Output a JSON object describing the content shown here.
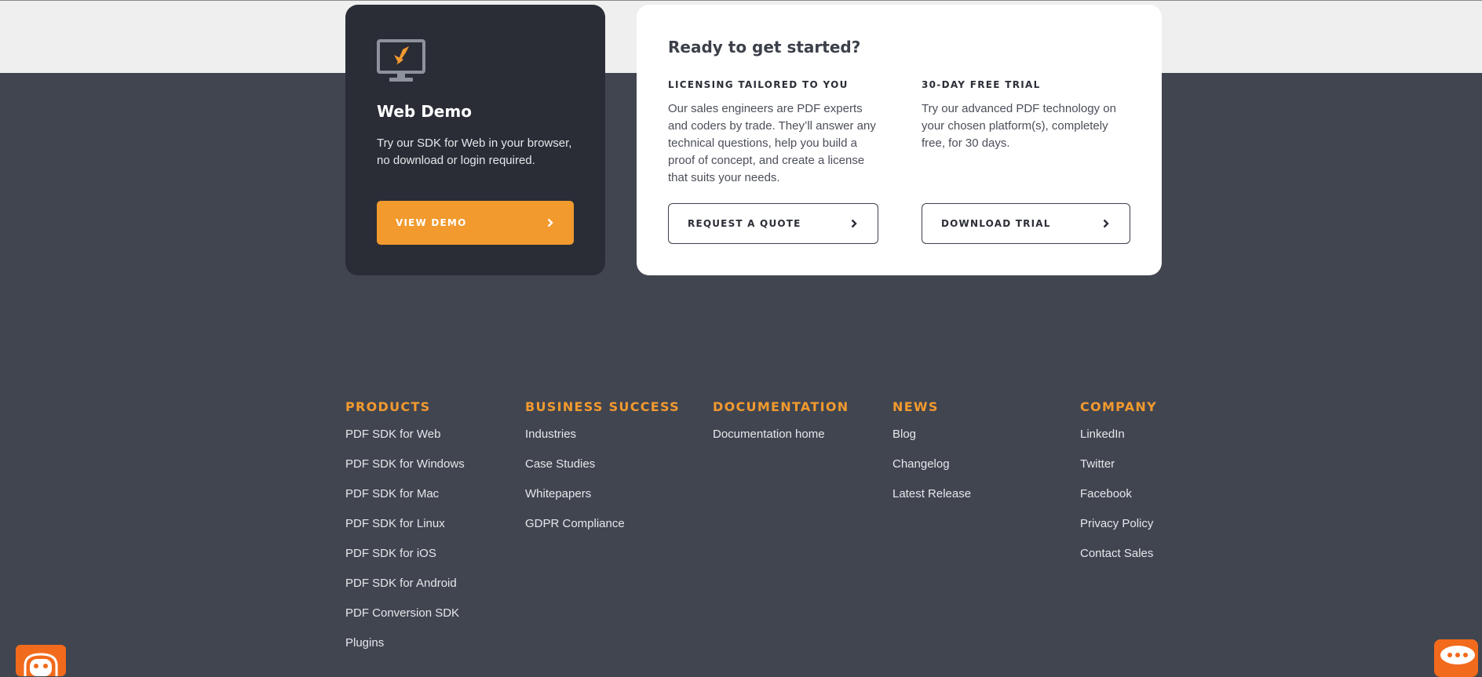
{
  "colors": {
    "accent": "#f29a2e",
    "footer_bg": "#414550",
    "card_dark": "#2a2d36",
    "widget": "#f26a1b"
  },
  "demo_card": {
    "icon": "monitor-icon",
    "title": "Web Demo",
    "description": "Try our SDK for Web in your browser, no download or login required.",
    "button_label": "VIEW DEMO"
  },
  "start_card": {
    "title": "Ready to get started?",
    "licensing": {
      "heading": "LICENSING TAILORED TO YOU",
      "text": "Our sales engineers are PDF experts and coders by trade. They’ll answer any technical questions, help you build a proof of concept, and create a license that suits your needs.",
      "button_label": "REQUEST A QUOTE"
    },
    "trial": {
      "heading": "30-DAY FREE TRIAL",
      "text": "Try our advanced PDF technology on your chosen platform(s), completely free, for 30 days.",
      "button_label": "DOWNLOAD TRIAL"
    }
  },
  "footer": {
    "products": {
      "heading": "PRODUCTS",
      "links": [
        "PDF SDK for Web",
        "PDF SDK for Windows",
        "PDF SDK for Mac",
        "PDF SDK for Linux",
        "PDF SDK for iOS",
        "PDF SDK for Android",
        "PDF Conversion SDK",
        "Plugins"
      ]
    },
    "business": {
      "heading": "BUSINESS SUCCESS",
      "links": [
        "Industries",
        "Case Studies",
        "Whitepapers",
        "GDPR Compliance"
      ]
    },
    "documentation": {
      "heading": "DOCUMENTATION",
      "links": [
        "Documentation home"
      ]
    },
    "news": {
      "heading": "NEWS",
      "links": [
        "Blog",
        "Changelog",
        "Latest Release"
      ]
    },
    "company": {
      "heading": "COMPANY",
      "links": [
        "LinkedIn",
        "Twitter",
        "Facebook",
        "Privacy Policy",
        "Contact Sales"
      ]
    }
  },
  "widgets": {
    "left_icon": "chatbot-icon",
    "right_icon": "chat-bubble-icon"
  }
}
